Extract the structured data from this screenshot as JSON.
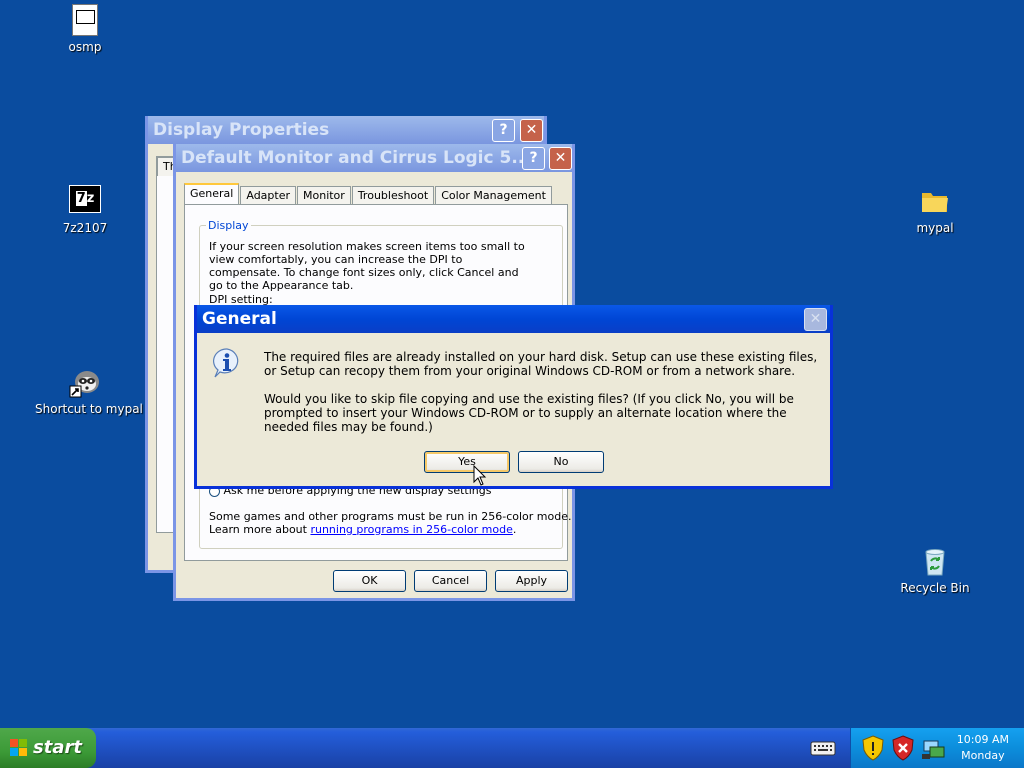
{
  "desktop": {
    "icons": [
      {
        "label": "osmp"
      },
      {
        "label": "7z2107"
      },
      {
        "label": "Shortcut to mypal"
      },
      {
        "label": "mypal"
      },
      {
        "label": "Recycle Bin"
      }
    ]
  },
  "display_properties": {
    "title": "Display Properties",
    "partial_tab": "Th"
  },
  "monitor_dialog": {
    "title": "Default Monitor and Cirrus Logic 5...",
    "tabs": [
      "General",
      "Adapter",
      "Monitor",
      "Troubleshoot",
      "Color Management"
    ],
    "display_group": {
      "legend": "Display",
      "text": "If your screen resolution makes screen items too small to view comfortably, you can increase the DPI to compensate.  To change font sizes only, click Cancel and go to the Appearance tab.",
      "dpi_label": "DPI setting:"
    },
    "partial_radio": "Ask me before applying the new display settings",
    "games_text": "Some games and other programs must be run in 256-color mode.",
    "learn_more_prefix": "Learn more about ",
    "learn_more_link": "running programs in 256-color mode",
    "learn_more_suffix": ".",
    "buttons": {
      "ok": "OK",
      "cancel": "Cancel",
      "apply": "Apply"
    }
  },
  "general_dialog": {
    "title": "General",
    "message1": "The required files are already installed on your hard disk. Setup can use these existing files, or Setup can recopy them from your original Windows CD-ROM or from a network share.",
    "message2": "Would you like to skip file copying and use the existing files? (If you click No, you will be prompted to insert your Windows CD-ROM or to supply an alternate location where the needed files may be found.)",
    "buttons": {
      "yes": "Yes",
      "no": "No"
    }
  },
  "taskbar": {
    "start_label": "start",
    "clock_time": "10:09 AM",
    "clock_day": "Monday"
  },
  "colors": {
    "desktop": "#0a4c9f",
    "active_title": "#0046d5",
    "start_green": "#3c9a37",
    "tray_blue": "#0c8edc"
  }
}
